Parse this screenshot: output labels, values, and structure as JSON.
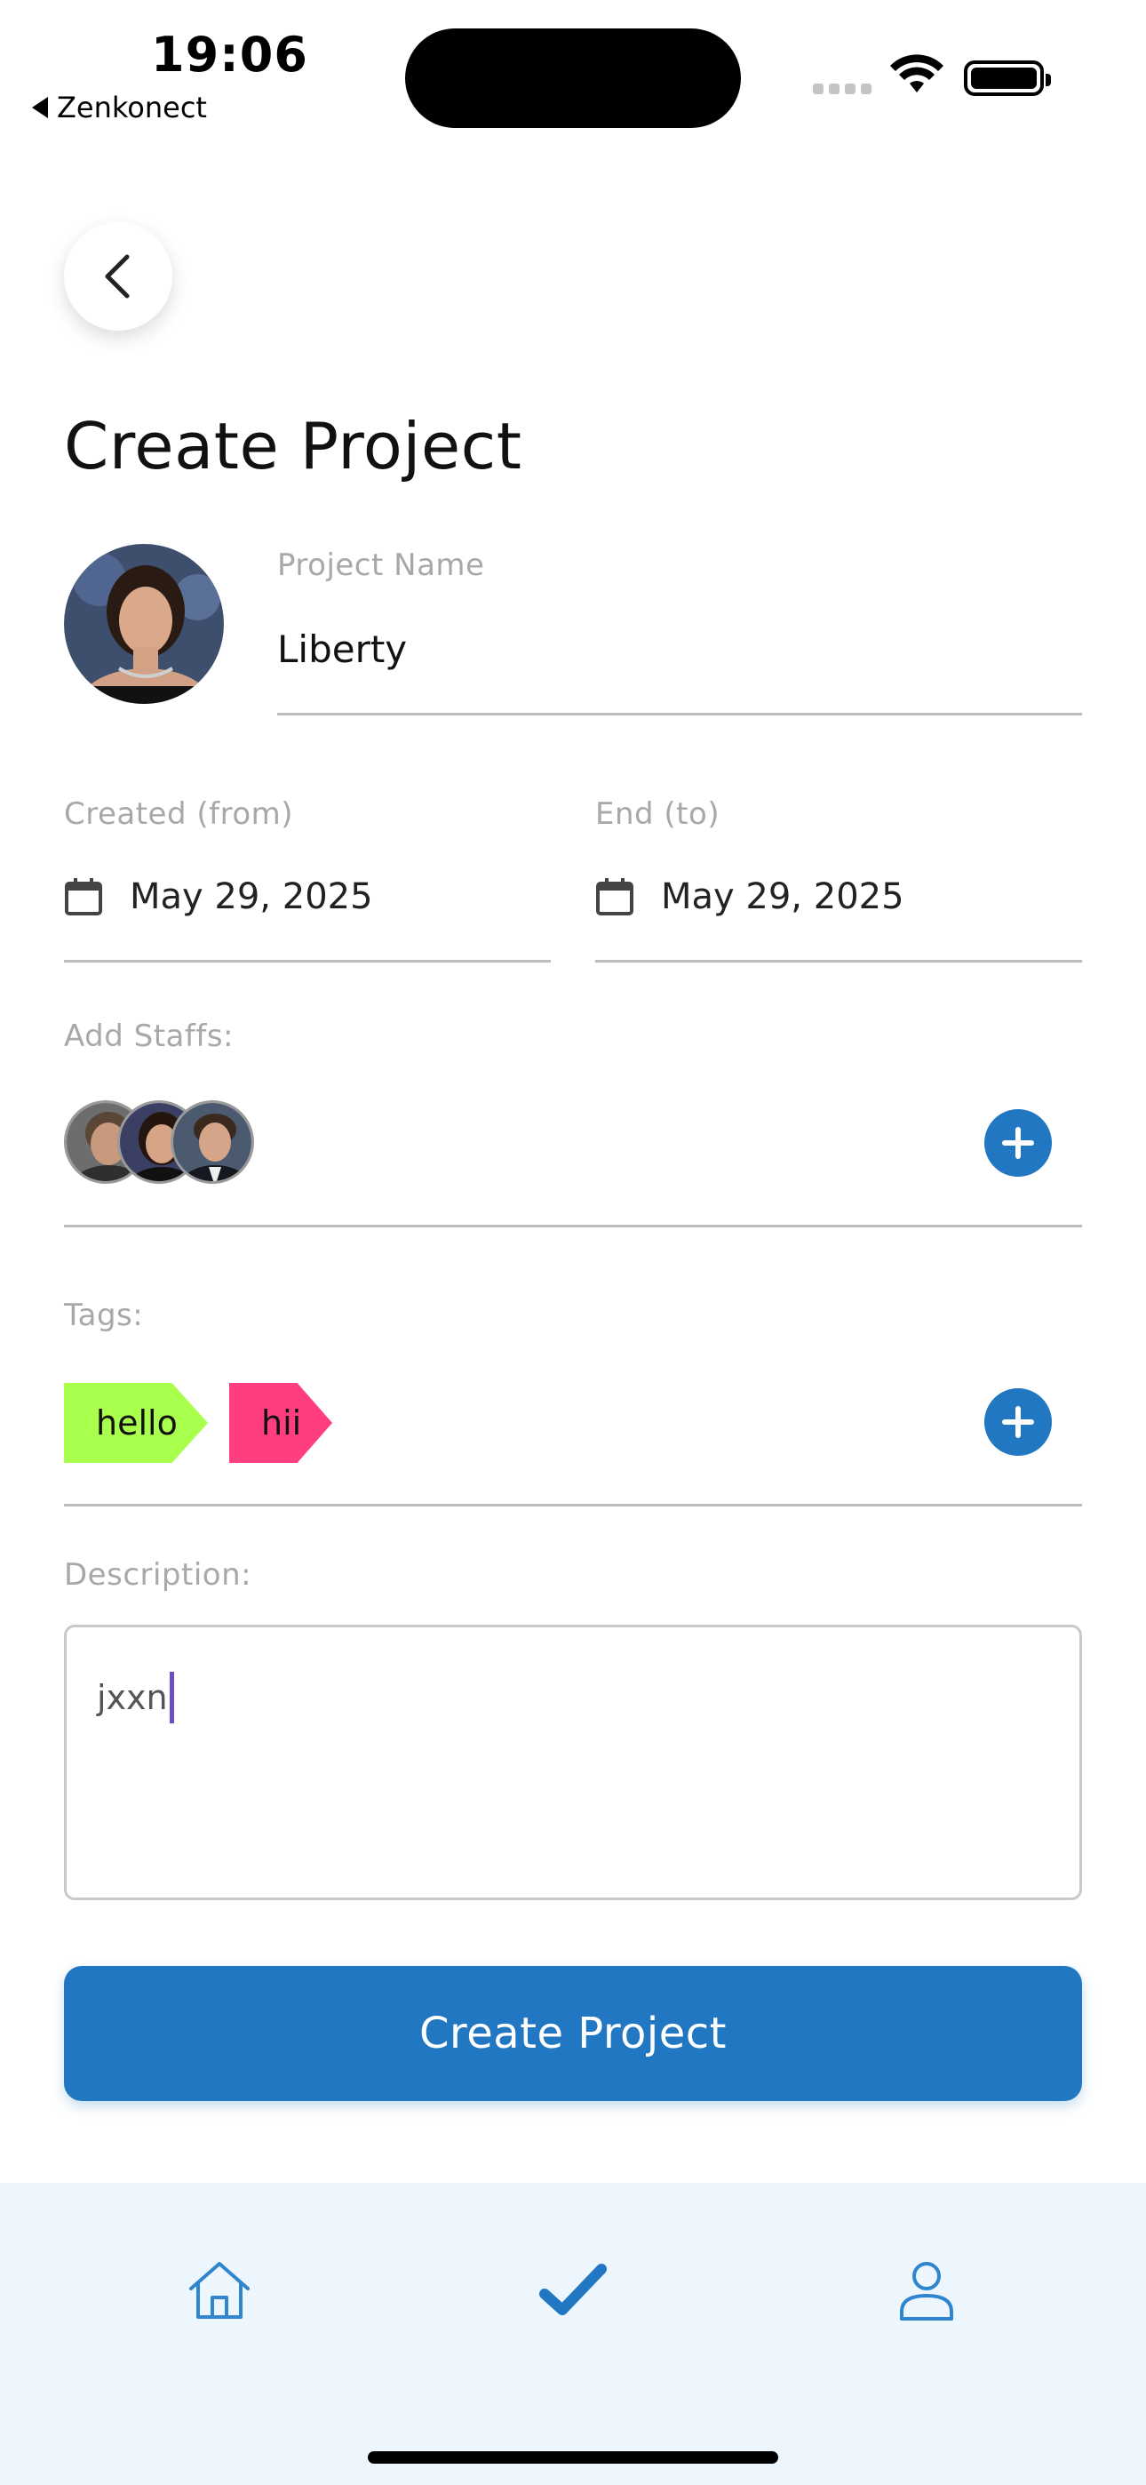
{
  "status_bar": {
    "time": "19:06",
    "back_app": "Zenkonect"
  },
  "header": {
    "title": "Create Project"
  },
  "form": {
    "project_name_label": "Project Name",
    "project_name_value": "Liberty",
    "created_label": "Created (from)",
    "created_value": "May 29, 2025",
    "end_label": "End (to)",
    "end_value": "May 29, 2025",
    "staffs_label": "Add Staffs:",
    "staff_count": 3,
    "tags_label": "Tags:",
    "tags": [
      {
        "label": "hello",
        "color": "#a8ff4c"
      },
      {
        "label": "hii",
        "color": "#ff3d7f"
      }
    ],
    "description_label": "Description:",
    "description_value": "jxxn"
  },
  "actions": {
    "create_label": "Create Project"
  },
  "tab_bar": {
    "items": [
      {
        "icon": "home-icon",
        "active": false
      },
      {
        "icon": "checkmark-icon",
        "active": true
      },
      {
        "icon": "user-icon",
        "active": false
      }
    ]
  },
  "colors": {
    "accent": "#2177c1",
    "tab_bar_bg": "#eef6fd",
    "caret": "#6b4fc2"
  }
}
